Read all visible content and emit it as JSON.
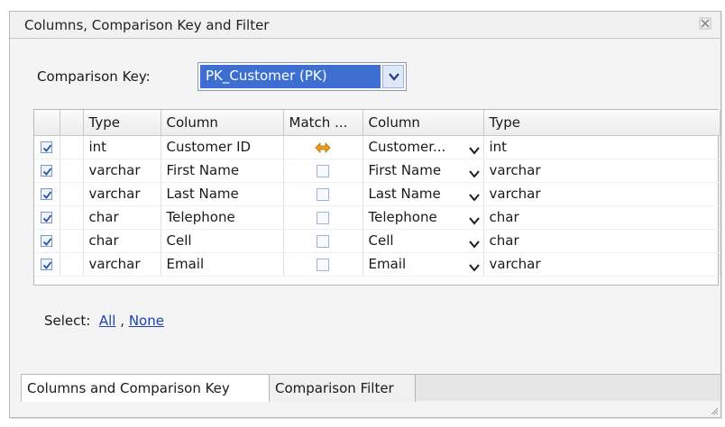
{
  "window": {
    "title": "Columns, Comparison Key and Filter",
    "close_icon": "close-icon"
  },
  "comparison_key": {
    "label": "Comparison Key:",
    "selected": "PK_Customer (PK)"
  },
  "table": {
    "headers": [
      "",
      "",
      "Type",
      "Column",
      "Match ...",
      "Column",
      "Type"
    ],
    "rows": [
      {
        "checked": true,
        "left_type": "int",
        "left_column": "Customer ID",
        "match": "key",
        "right_column": "Customer...",
        "right_type": "int"
      },
      {
        "checked": true,
        "left_type": "varchar",
        "left_column": "First Name",
        "match": "box",
        "right_column": "First Name",
        "right_type": "varchar"
      },
      {
        "checked": true,
        "left_type": "varchar",
        "left_column": "Last Name",
        "match": "box",
        "right_column": "Last Name",
        "right_type": "varchar"
      },
      {
        "checked": true,
        "left_type": "char",
        "left_column": "Telephone",
        "match": "box",
        "right_column": "Telephone",
        "right_type": "char"
      },
      {
        "checked": true,
        "left_type": "char",
        "left_column": "Cell",
        "match": "box",
        "right_column": "Cell",
        "right_type": "char"
      },
      {
        "checked": true,
        "left_type": "varchar",
        "left_column": "Email",
        "match": "box",
        "right_column": "Email",
        "right_type": "varchar"
      }
    ]
  },
  "select": {
    "label": "Select:",
    "all": "All",
    "separator": ",",
    "none": "None"
  },
  "tabs": [
    {
      "label": "Columns and Comparison Key",
      "active": true
    },
    {
      "label": "Comparison Filter",
      "active": false
    }
  ],
  "colors": {
    "accent": "#3c6fd0",
    "link": "#1d3fb3",
    "key_icon": "#e8a21a"
  }
}
